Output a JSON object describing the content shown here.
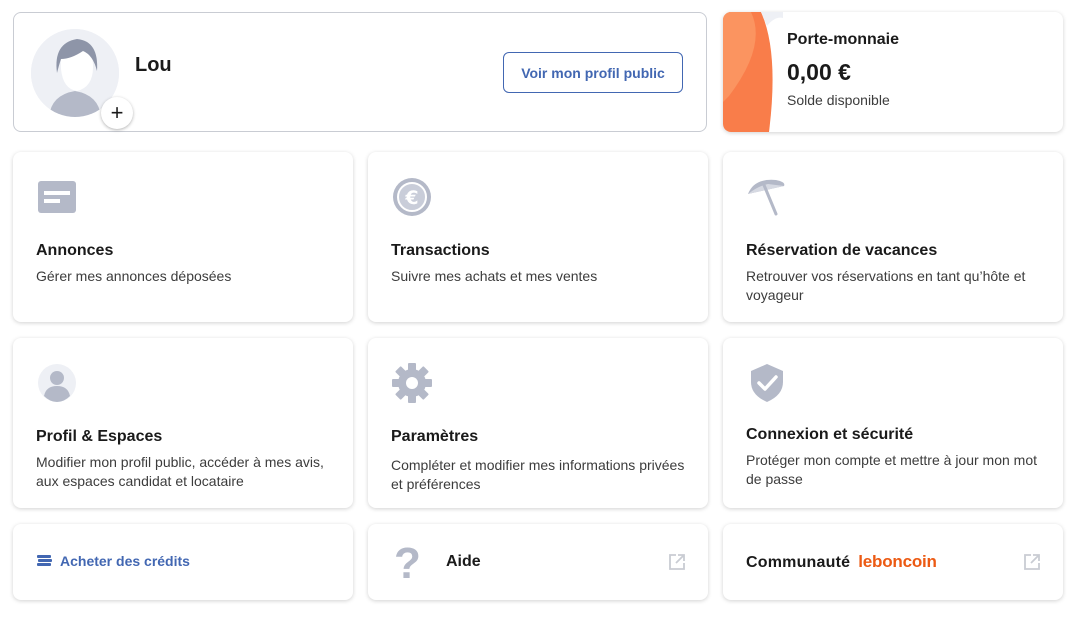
{
  "profile": {
    "name": "Lou",
    "add_symbol": "+",
    "public_profile_button": "Voir mon profil public"
  },
  "wallet": {
    "title": "Porte-monnaie",
    "amount": "0,00 €",
    "subtitle": "Solde disponible"
  },
  "tiles": [
    {
      "title": "Annonces",
      "desc": "Gérer mes annonces déposées",
      "icon": "listing-icon"
    },
    {
      "title": "Transactions",
      "desc": "Suivre mes achats et mes ventes",
      "icon": "euro-coin-icon"
    },
    {
      "title": "Réservation de vacances",
      "desc": "Retrouver vos réservations en tant qu’hôte et voyageur",
      "icon": "beach-umbrella-icon"
    },
    {
      "title": "Profil & Espaces",
      "desc": "Modifier mon profil public, accéder à mes avis, aux espaces candidat et locataire",
      "icon": "user-icon"
    },
    {
      "title": "Paramètres",
      "desc": "Compléter et modifier mes informations privées et préférences",
      "icon": "gear-icon"
    },
    {
      "title": "Connexion et sécurité",
      "desc": "Protéger mon compte et mettre à jour mon mot de passe",
      "icon": "shield-check-icon"
    }
  ],
  "bottom": {
    "credits": "Acheter des crédits",
    "help": "Aide",
    "help_symbol": "?",
    "community": "Communauté",
    "brand": "leboncoin"
  },
  "colors": {
    "accent_blue": "#4267b2",
    "brand_orange": "#ec5a13",
    "icon_gray": "#b4b9c8"
  }
}
